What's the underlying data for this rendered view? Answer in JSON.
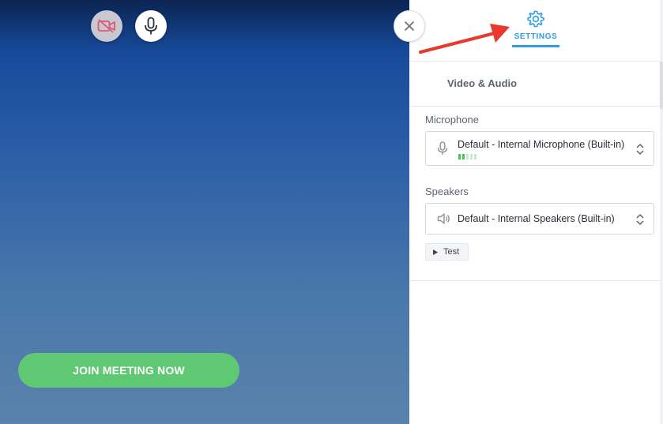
{
  "left": {
    "camera_icon": "video-off-icon",
    "mic_icon": "microphone-icon",
    "join_label": "JOIN MEETING NOW"
  },
  "panel": {
    "settings_tab_label": "SETTINGS",
    "settings_icon": "gear-icon",
    "section_title": "Video & Audio",
    "microphone": {
      "label": "Microphone",
      "value": "Default - Internal Microphone (Built-in)",
      "level": 0.4
    },
    "speakers": {
      "label": "Speakers",
      "value": "Default - Internal Speakers (Built-in)"
    },
    "test_label": "Test"
  },
  "colors": {
    "accent": "#2f9ee0",
    "join": "#5fc873",
    "camera_off": "#e0557a",
    "arrow": "#e8392e"
  }
}
